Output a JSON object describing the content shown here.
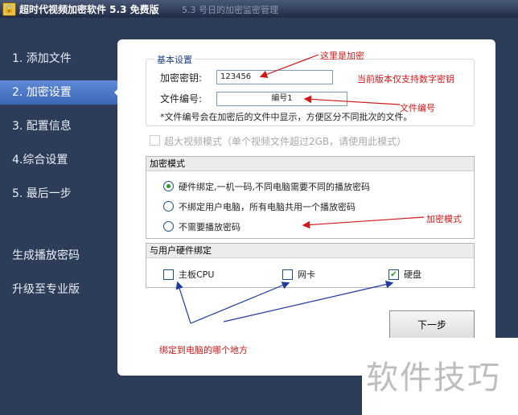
{
  "window": {
    "title": "超时代视频加密软件 5.3  免费版",
    "ghost_text": "5.3 号日的加密监密管理"
  },
  "sidebar": {
    "items": [
      {
        "label": "1. 添加文件"
      },
      {
        "label": "2. 加密设置"
      },
      {
        "label": "3. 配置信息"
      },
      {
        "label": "4.综合设置"
      },
      {
        "label": "5. 最后一步"
      },
      {
        "label": "生成播放密码"
      },
      {
        "label": "升级至专业版"
      }
    ]
  },
  "basic": {
    "legend": "基本设置",
    "key_label": "加密密钥:",
    "key_value": "123456",
    "fileno_label": "文件编号:",
    "fileno_value": "编号1",
    "hint": "*文件编号会在加密后的文件中显示，方便区分不同批次的文件。"
  },
  "large_video": {
    "label": "超大视频模式（单个视频文件超过2GB，请使用此模式）"
  },
  "mode": {
    "title": "加密模式",
    "options": [
      {
        "label": "硬件绑定,一机一码,不同电脑需要不同的播放密码"
      },
      {
        "label": "不绑定用户电脑，所有电脑共用一个播放密码"
      },
      {
        "label": "不需要播放密码"
      }
    ]
  },
  "binding": {
    "title": "与用户硬件绑定",
    "items": [
      {
        "label": "主板CPU"
      },
      {
        "label": "网卡"
      },
      {
        "label": "硬盘"
      }
    ]
  },
  "next_button": "下一步",
  "annotations": {
    "encrypt_here": "这里是加密",
    "digits_only": "当前版本仅支持数字密钥",
    "file_number": "文件编号",
    "encrypt_mode": "加密模式",
    "bind_which": "绑定到电脑的哪个地方"
  },
  "watermark": "软件技巧"
}
